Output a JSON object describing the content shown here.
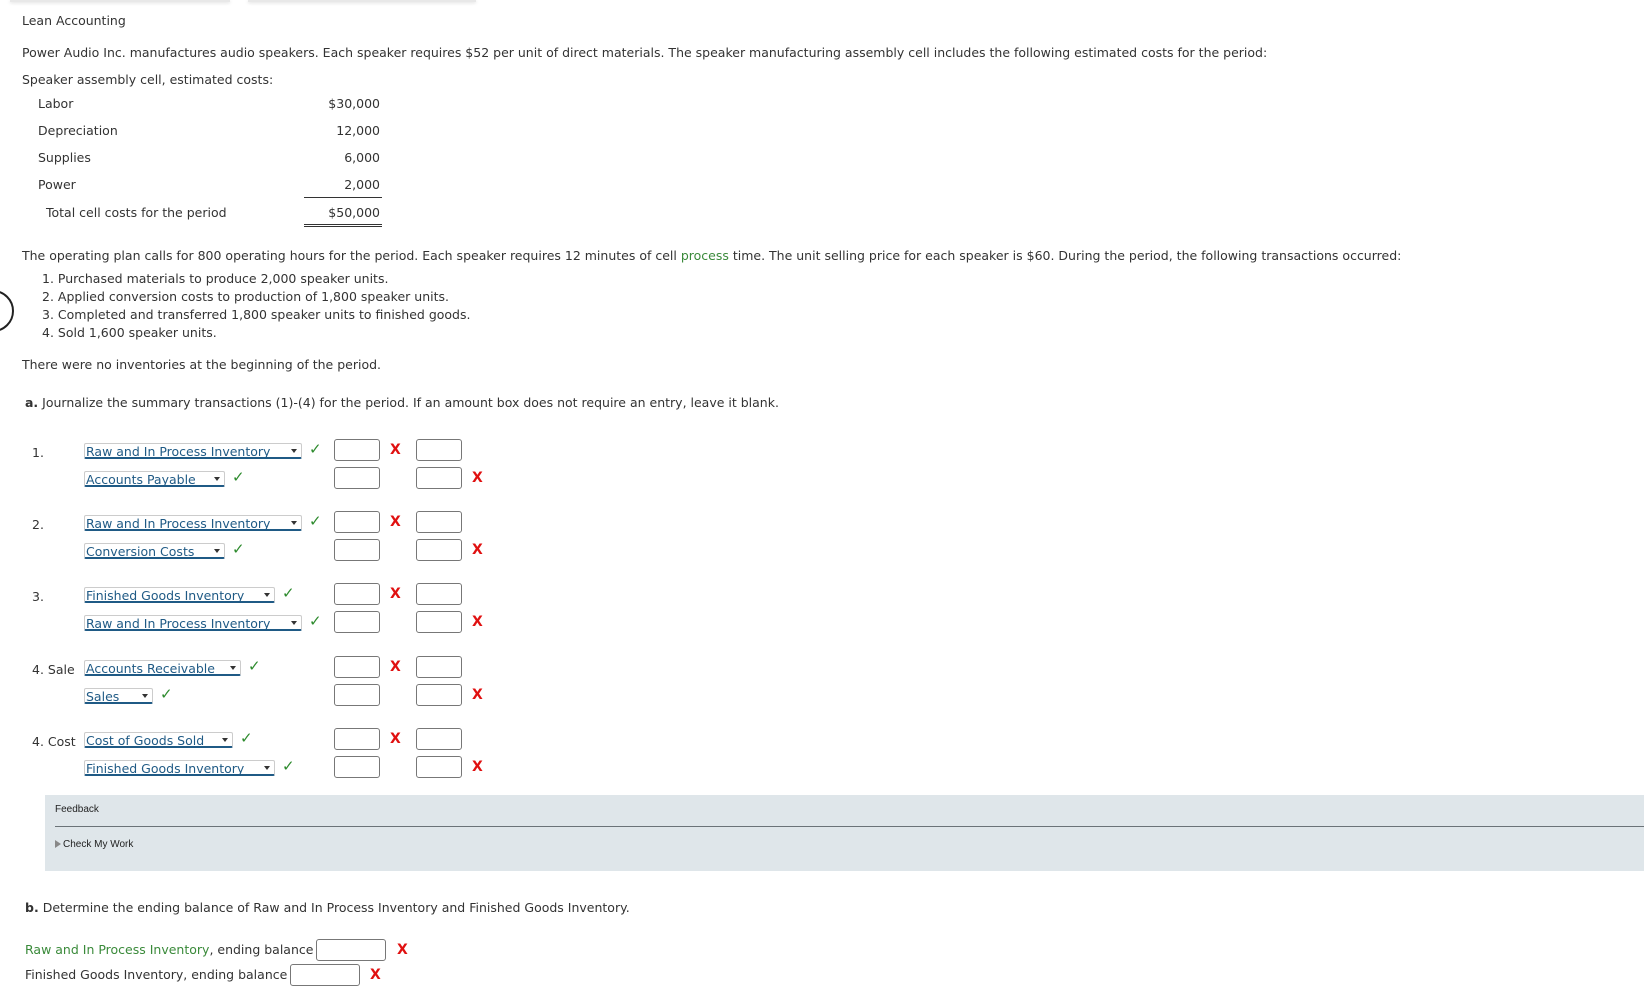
{
  "page": {
    "section_title": "Lean Accounting",
    "intro": "Power Audio Inc. manufactures audio speakers. Each speaker requires $52 per unit of direct materials. The speaker manufacturing assembly cell includes the following estimated costs for the period:",
    "costs_heading": "Speaker assembly cell, estimated costs:",
    "costs": [
      {
        "label": "Labor",
        "value": "$30,000"
      },
      {
        "label": "Depreciation",
        "value": "12,000"
      },
      {
        "label": "Supplies",
        "value": "6,000"
      },
      {
        "label": "Power",
        "value": "2,000"
      }
    ],
    "total": {
      "label": "Total cell costs for the period",
      "value": "$50,000"
    },
    "plan_text_before": "The operating plan calls for 800 operating hours for the period. Each speaker requires 12 minutes of cell ",
    "plan_link": "process",
    "plan_text_after": " time. The unit selling price for each speaker is $60. During the period, the following transactions occurred:",
    "transactions": [
      "1. Purchased materials to produce 2,000 speaker units.",
      "2. Applied conversion costs to production of 1,800 speaker units.",
      "3. Completed and transferred 1,800 speaker units to finished goods.",
      "4. Sold 1,600 speaker units."
    ],
    "no_inventories": "There were no inventories at the beginning of the period."
  },
  "part_a": {
    "marker": "a.",
    "instruction": "Journalize the summary transactions (1)-(4) for the period. If an amount box does not require an entry, leave it blank.",
    "entries": [
      {
        "label": "1.",
        "debit_account": "Raw and In Process Inventory",
        "credit_account": "Accounts Payable"
      },
      {
        "label": "2.",
        "debit_account": "Raw and In Process Inventory",
        "credit_account": "Conversion Costs"
      },
      {
        "label": "3.",
        "debit_account": "Finished Goods Inventory",
        "credit_account": "Raw and In Process Inventory"
      },
      {
        "label": "4. Sale",
        "debit_account": "Accounts Receivable",
        "credit_account": "Sales"
      },
      {
        "label": "4. Cost",
        "debit_account": "Cost of Goods Sold",
        "credit_account": "Finished Goods Inventory"
      }
    ],
    "check_glyph": "✓",
    "x_glyph": "X"
  },
  "feedback": {
    "title": "Feedback",
    "check_my_work": "Check My Work"
  },
  "part_b": {
    "marker": "b.",
    "instruction": "Determine the ending balance of Raw and In Process Inventory and Finished Goods Inventory.",
    "raw_label_link": "Raw and In Process Inventory",
    "raw_label_rest": ", ending balance $",
    "fg_label": "Finished Goods Inventory, ending balance $",
    "raw_value": "",
    "fg_value": ""
  }
}
